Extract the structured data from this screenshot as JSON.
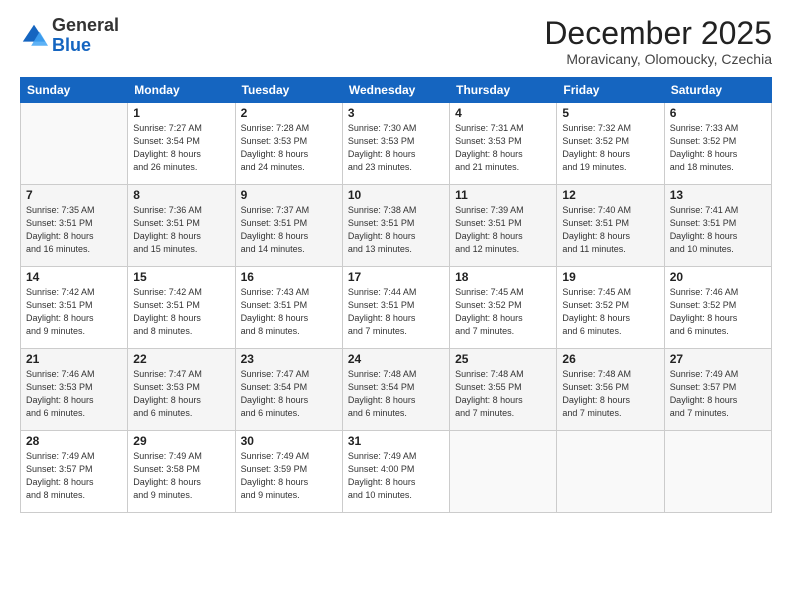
{
  "logo": {
    "general": "General",
    "blue": "Blue"
  },
  "header": {
    "month": "December 2025",
    "location": "Moravicany, Olomoucky, Czechia"
  },
  "weekdays": [
    "Sunday",
    "Monday",
    "Tuesday",
    "Wednesday",
    "Thursday",
    "Friday",
    "Saturday"
  ],
  "weeks": [
    [
      {
        "day": "",
        "info": ""
      },
      {
        "day": "1",
        "info": "Sunrise: 7:27 AM\nSunset: 3:54 PM\nDaylight: 8 hours\nand 26 minutes."
      },
      {
        "day": "2",
        "info": "Sunrise: 7:28 AM\nSunset: 3:53 PM\nDaylight: 8 hours\nand 24 minutes."
      },
      {
        "day": "3",
        "info": "Sunrise: 7:30 AM\nSunset: 3:53 PM\nDaylight: 8 hours\nand 23 minutes."
      },
      {
        "day": "4",
        "info": "Sunrise: 7:31 AM\nSunset: 3:53 PM\nDaylight: 8 hours\nand 21 minutes."
      },
      {
        "day": "5",
        "info": "Sunrise: 7:32 AM\nSunset: 3:52 PM\nDaylight: 8 hours\nand 19 minutes."
      },
      {
        "day": "6",
        "info": "Sunrise: 7:33 AM\nSunset: 3:52 PM\nDaylight: 8 hours\nand 18 minutes."
      }
    ],
    [
      {
        "day": "7",
        "info": "Sunrise: 7:35 AM\nSunset: 3:51 PM\nDaylight: 8 hours\nand 16 minutes."
      },
      {
        "day": "8",
        "info": "Sunrise: 7:36 AM\nSunset: 3:51 PM\nDaylight: 8 hours\nand 15 minutes."
      },
      {
        "day": "9",
        "info": "Sunrise: 7:37 AM\nSunset: 3:51 PM\nDaylight: 8 hours\nand 14 minutes."
      },
      {
        "day": "10",
        "info": "Sunrise: 7:38 AM\nSunset: 3:51 PM\nDaylight: 8 hours\nand 13 minutes."
      },
      {
        "day": "11",
        "info": "Sunrise: 7:39 AM\nSunset: 3:51 PM\nDaylight: 8 hours\nand 12 minutes."
      },
      {
        "day": "12",
        "info": "Sunrise: 7:40 AM\nSunset: 3:51 PM\nDaylight: 8 hours\nand 11 minutes."
      },
      {
        "day": "13",
        "info": "Sunrise: 7:41 AM\nSunset: 3:51 PM\nDaylight: 8 hours\nand 10 minutes."
      }
    ],
    [
      {
        "day": "14",
        "info": "Sunrise: 7:42 AM\nSunset: 3:51 PM\nDaylight: 8 hours\nand 9 minutes."
      },
      {
        "day": "15",
        "info": "Sunrise: 7:42 AM\nSunset: 3:51 PM\nDaylight: 8 hours\nand 8 minutes."
      },
      {
        "day": "16",
        "info": "Sunrise: 7:43 AM\nSunset: 3:51 PM\nDaylight: 8 hours\nand 8 minutes."
      },
      {
        "day": "17",
        "info": "Sunrise: 7:44 AM\nSunset: 3:51 PM\nDaylight: 8 hours\nand 7 minutes."
      },
      {
        "day": "18",
        "info": "Sunrise: 7:45 AM\nSunset: 3:52 PM\nDaylight: 8 hours\nand 7 minutes."
      },
      {
        "day": "19",
        "info": "Sunrise: 7:45 AM\nSunset: 3:52 PM\nDaylight: 8 hours\nand 6 minutes."
      },
      {
        "day": "20",
        "info": "Sunrise: 7:46 AM\nSunset: 3:52 PM\nDaylight: 8 hours\nand 6 minutes."
      }
    ],
    [
      {
        "day": "21",
        "info": "Sunrise: 7:46 AM\nSunset: 3:53 PM\nDaylight: 8 hours\nand 6 minutes."
      },
      {
        "day": "22",
        "info": "Sunrise: 7:47 AM\nSunset: 3:53 PM\nDaylight: 8 hours\nand 6 minutes."
      },
      {
        "day": "23",
        "info": "Sunrise: 7:47 AM\nSunset: 3:54 PM\nDaylight: 8 hours\nand 6 minutes."
      },
      {
        "day": "24",
        "info": "Sunrise: 7:48 AM\nSunset: 3:54 PM\nDaylight: 8 hours\nand 6 minutes."
      },
      {
        "day": "25",
        "info": "Sunrise: 7:48 AM\nSunset: 3:55 PM\nDaylight: 8 hours\nand 7 minutes."
      },
      {
        "day": "26",
        "info": "Sunrise: 7:48 AM\nSunset: 3:56 PM\nDaylight: 8 hours\nand 7 minutes."
      },
      {
        "day": "27",
        "info": "Sunrise: 7:49 AM\nSunset: 3:57 PM\nDaylight: 8 hours\nand 7 minutes."
      }
    ],
    [
      {
        "day": "28",
        "info": "Sunrise: 7:49 AM\nSunset: 3:57 PM\nDaylight: 8 hours\nand 8 minutes."
      },
      {
        "day": "29",
        "info": "Sunrise: 7:49 AM\nSunset: 3:58 PM\nDaylight: 8 hours\nand 9 minutes."
      },
      {
        "day": "30",
        "info": "Sunrise: 7:49 AM\nSunset: 3:59 PM\nDaylight: 8 hours\nand 9 minutes."
      },
      {
        "day": "31",
        "info": "Sunrise: 7:49 AM\nSunset: 4:00 PM\nDaylight: 8 hours\nand 10 minutes."
      },
      {
        "day": "",
        "info": ""
      },
      {
        "day": "",
        "info": ""
      },
      {
        "day": "",
        "info": ""
      }
    ]
  ]
}
